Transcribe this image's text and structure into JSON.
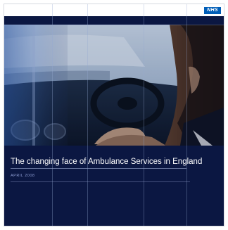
{
  "document": {
    "title": "The changing face of Ambulance Services in England",
    "date": "APRIL 2008",
    "logo_text": "NHS"
  },
  "colors": {
    "navy": "#0b1742",
    "logo_blue": "#005eb8"
  },
  "cover_image": {
    "icon": "car-interior-photo"
  }
}
